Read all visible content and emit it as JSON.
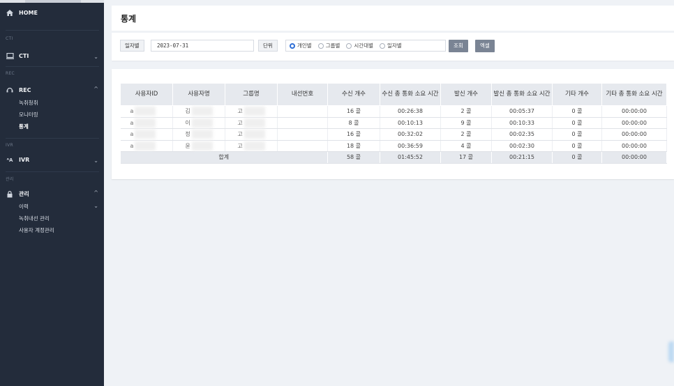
{
  "sidebar": {
    "home": "HOME",
    "sections": {
      "cti": "CTI",
      "rec": "REC",
      "ivr": "IVR",
      "admin": "관리"
    },
    "cti": "CTI",
    "rec": "REC",
    "rec_items": [
      "녹취청취",
      "모니터링",
      "통계"
    ],
    "ivr": "IVR",
    "admin": "관리",
    "admin_items": [
      "이력",
      "녹취내선 관리",
      "사용자 계정관리"
    ]
  },
  "page": {
    "title": "통계"
  },
  "filter": {
    "date_label": "일자별",
    "date_value": "2023-07-31",
    "unit_label": "단위",
    "radios": [
      "개인별",
      "그룹별",
      "시간대별",
      "일자별"
    ],
    "selected": "개인별",
    "search_btn": "조회",
    "excel_btn": "엑셀"
  },
  "table": {
    "headers": [
      "사용자ID",
      "사용자명",
      "그룹명",
      "내선번호",
      "수신 개수",
      "수신 총 통화 소요 시간",
      "발신 개수",
      "발신 총 통화 소요 시간",
      "기타 개수",
      "기타 총 통화 소요 시간"
    ],
    "rows": [
      [
        "a",
        "김",
        "고",
        "",
        "16 콜",
        "00:26:38",
        "2 콜",
        "00:05:37",
        "0 콜",
        "00:00:00"
      ],
      [
        "a",
        "이",
        "고",
        "",
        "8 콜",
        "00:10:13",
        "9 콜",
        "00:10:33",
        "0 콜",
        "00:00:00"
      ],
      [
        "a",
        "정",
        "고",
        "",
        "16 콜",
        "00:32:02",
        "2 콜",
        "00:02:35",
        "0 콜",
        "00:00:00"
      ],
      [
        "a",
        "윤",
        "고",
        "",
        "18 콜",
        "00:36:59",
        "4 콜",
        "00:02:30",
        "0 콜",
        "00:00:00"
      ]
    ],
    "total": {
      "label": "합계",
      "cells": [
        "58 콜",
        "01:45:52",
        "17 콜",
        "00:21:15",
        "0 콜",
        "00:00:00"
      ]
    }
  },
  "colors": {
    "sidebar": "#232c3b",
    "accent": "#2f6fd6",
    "button": "#7a8494"
  }
}
